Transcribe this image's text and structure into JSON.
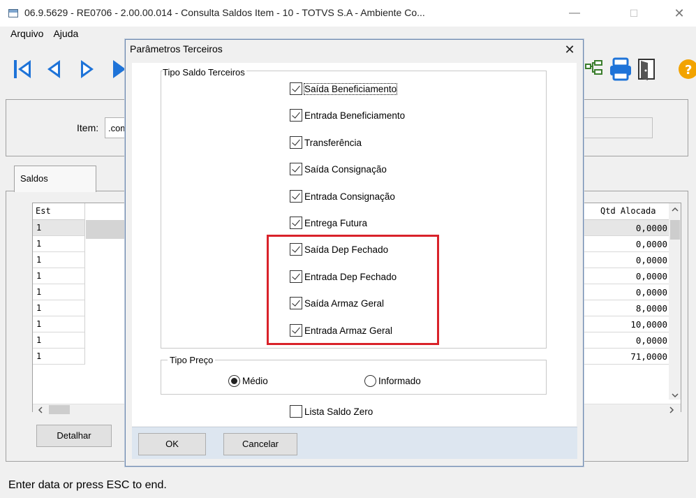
{
  "window": {
    "title": "06.9.5629 - RE0706 - 2.00.00.014 - Consulta Saldos Item - 10 - TOTVS S.A - Ambiente Co...",
    "minimize": "—",
    "maximize": "☐",
    "close": "✕"
  },
  "menu": [
    "Arquivo",
    "Ajuda"
  ],
  "form": {
    "item_label": "Item:",
    "item_value": ".com"
  },
  "tabs": {
    "saldos": "Saldos"
  },
  "grid": {
    "col_est": "Est",
    "col_qtd": "Qtd Alocada",
    "rows": [
      {
        "est": "1",
        "qtd": "0,0000"
      },
      {
        "est": "1",
        "qtd": "0,0000"
      },
      {
        "est": "1",
        "qtd": "0,0000"
      },
      {
        "est": "1",
        "qtd": "0,0000"
      },
      {
        "est": "1",
        "qtd": "0,0000"
      },
      {
        "est": "1",
        "qtd": "8,0000"
      },
      {
        "est": "1",
        "qtd": "10,0000"
      },
      {
        "est": "1",
        "qtd": "0,0000"
      },
      {
        "est": "1",
        "qtd": "71,0000"
      }
    ]
  },
  "buttons": {
    "detalhar": "Detalhar"
  },
  "status": "Enter data or press ESC to end.",
  "dialog": {
    "title": "Parâmetros Terceiros",
    "close": "✕",
    "group_tipo": "Tipo Saldo Terceiros",
    "checkboxes": [
      {
        "label": "Saída Beneficiamento",
        "checked": true
      },
      {
        "label": "Entrada Beneficiamento",
        "checked": true
      },
      {
        "label": "Transferência",
        "checked": true
      },
      {
        "label": "Saída Consignação",
        "checked": true
      },
      {
        "label": "Entrada Consignação",
        "checked": true
      },
      {
        "label": "Entrega Futura",
        "checked": true
      },
      {
        "label": "Saída Dep Fechado",
        "checked": true
      },
      {
        "label": "Entrada Dep Fechado",
        "checked": true
      },
      {
        "label": "Saída Armaz Geral",
        "checked": true
      },
      {
        "label": "Entrada Armaz Geral",
        "checked": true
      }
    ],
    "group_preco": "Tipo Preço",
    "radio_medio": "Médio",
    "radio_informado": "Informado",
    "selected_preco": "Médio",
    "lista_saldo_zero": "Lista Saldo Zero",
    "lista_saldo_zero_checked": false,
    "ok": "OK",
    "cancelar": "Cancelar",
    "highlight_color": "#d9222a"
  }
}
